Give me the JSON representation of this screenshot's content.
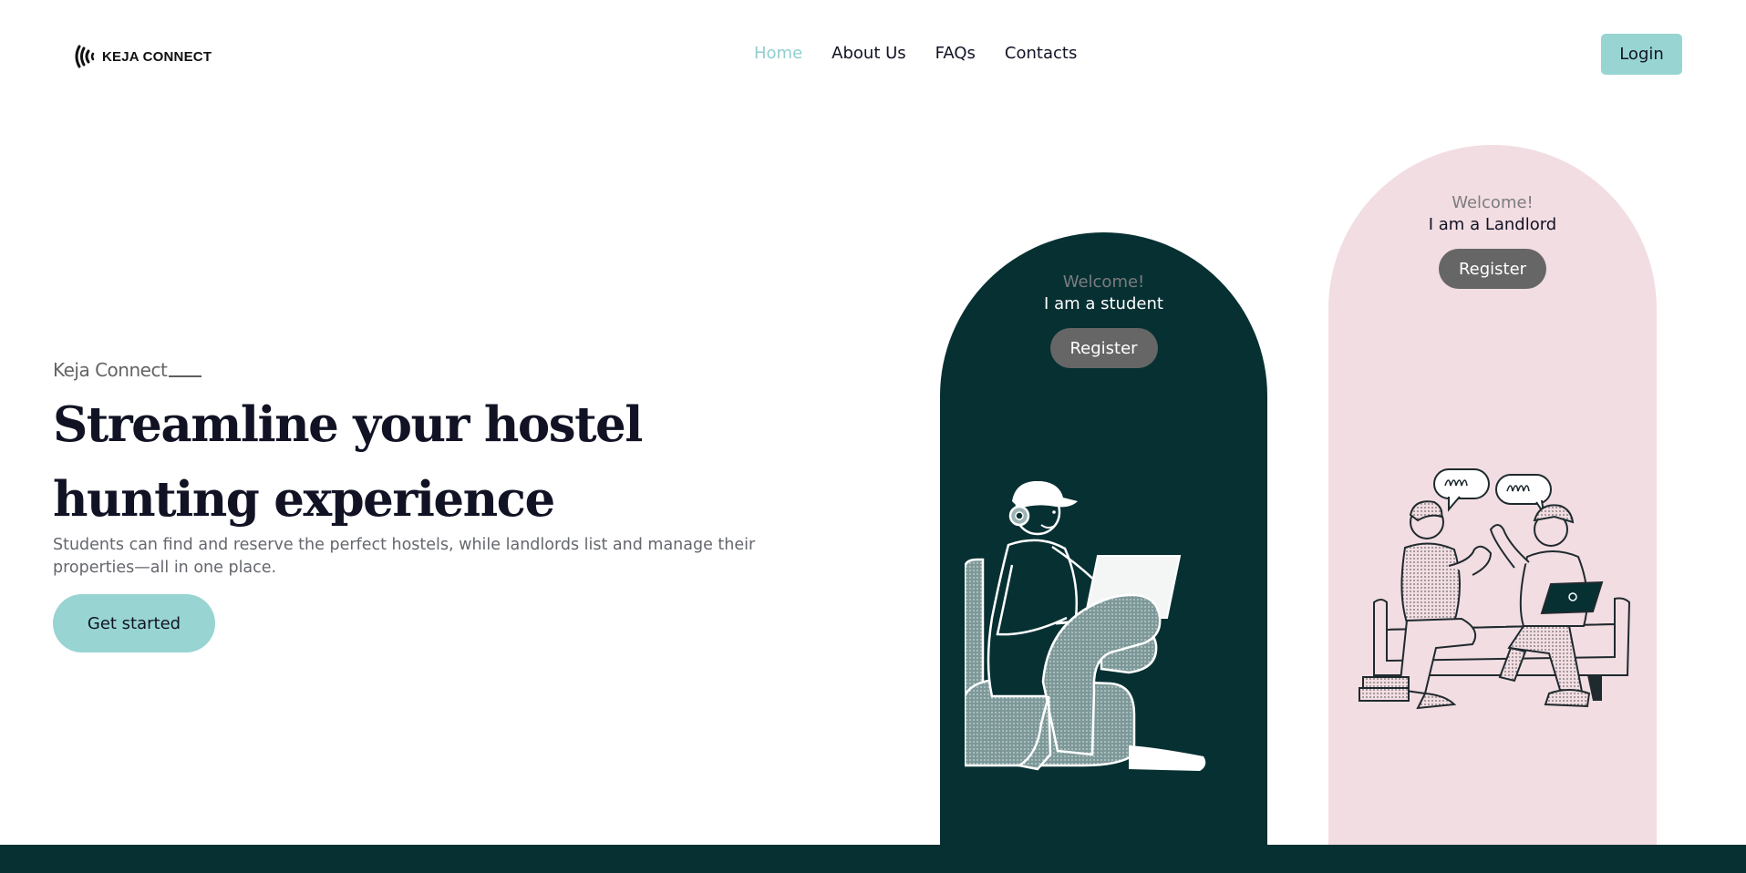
{
  "brand": {
    "name": "KEJA CONNECT",
    "logo_icon": "sound-wave-logo-icon"
  },
  "nav": {
    "items": [
      {
        "label": "Home",
        "active": true
      },
      {
        "label": "About Us",
        "active": false
      },
      {
        "label": "FAQs",
        "active": false
      },
      {
        "label": "Contacts",
        "active": false
      }
    ],
    "active_color": "#8fcfcf"
  },
  "header": {
    "login_label": "Login"
  },
  "hero": {
    "eyebrow": "Keja Connect",
    "title": "Streamline your hostel hunting experience",
    "subtitle": "Students can find and reserve the perfect hostels, while landlords list and manage their properties—all in one place.",
    "cta_label": "Get started"
  },
  "cards": {
    "student": {
      "welcome": "Welcome!",
      "role": "I am a student",
      "register_label": "Register",
      "illustration": "student-with-laptop-illustration",
      "bg_color": "#073033"
    },
    "landlord": {
      "welcome": "Welcome!",
      "role": "I am a Landlord",
      "register_label": "Register",
      "illustration": "two-people-chatting-on-sofa-illustration",
      "bg_color": "#f2dde2"
    }
  },
  "colors": {
    "accent": "#97d4d2",
    "dark_teal": "#073033",
    "pink": "#f2dde2",
    "register_button": "#666666"
  }
}
